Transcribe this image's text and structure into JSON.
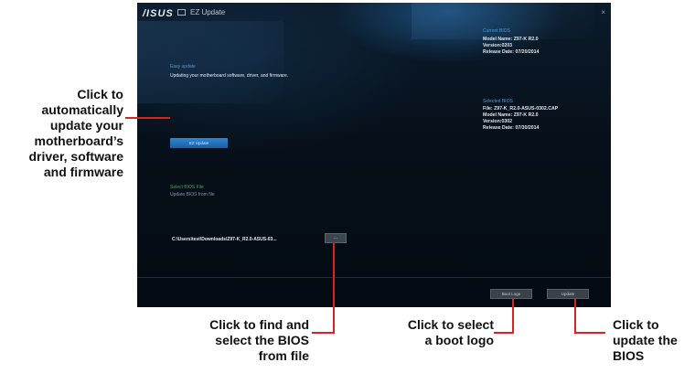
{
  "window": {
    "logo": "/ISUS",
    "title": "EZ Update",
    "close": "×"
  },
  "left_panel": {
    "ez_heading": "Easy update",
    "ez_description": "Updating your motherboard software, driver, and firmware.",
    "ez_button": "EZ Update",
    "bios_heading": "Select BIOS File",
    "bios_description": "Update BIOS from file",
    "file_path": "C:\\Users\\test\\Downloads\\Z97-K_R2.0-ASUS-03...",
    "browse_button": "..."
  },
  "current_bios": {
    "heading": "Current BIOS",
    "model": "Model Name: Z97-K R2.0",
    "version": "Version:0203",
    "release": "Release Date: 07/20/2014"
  },
  "selected_bios": {
    "heading": "Selected BIOS",
    "file": "File: Z97-K_R2.0-ASUS-0302.CAP",
    "model": "Model Name: Z97-K R2.0",
    "version": "Version:0302",
    "release": "Release Date: 07/30/2014"
  },
  "footer": {
    "boot_logo_button": "Boot Logo",
    "update_button": "Update"
  },
  "callouts": {
    "left_lines": [
      "Click to",
      "automatically",
      "update your",
      "motherboard’s",
      "driver, software",
      "and firmware"
    ],
    "find_lines": [
      "Click to find and",
      "select the BIOS",
      "from file"
    ],
    "logo_lines": [
      "Click to select",
      "a boot logo"
    ],
    "update_lines": [
      "Click to",
      "update the",
      "BIOS"
    ]
  },
  "colors": {
    "accent_red": "#d8231f",
    "window_bg": "#07111c",
    "ez_button_blue": "#2f86d0",
    "heading_blue": "#4f9ad8"
  }
}
